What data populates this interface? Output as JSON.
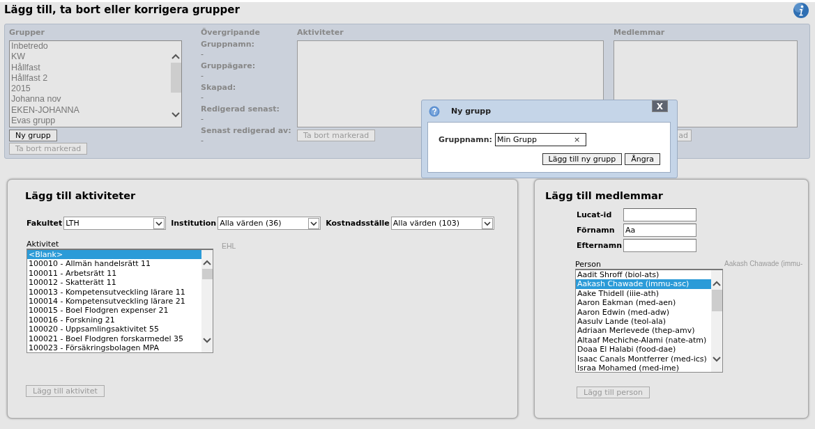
{
  "page": {
    "title": "Lägg till, ta bort eller korrigera grupper"
  },
  "groups_panel": {
    "heading": "Grupper",
    "list_disabled": true,
    "items": [
      {
        "label": "Inbetredo",
        "selected": false
      },
      {
        "label": "KW",
        "selected": false
      },
      {
        "label": "Hållfast",
        "selected": false
      },
      {
        "label": "Hållfast 2",
        "selected": false
      },
      {
        "label": "2015",
        "selected": false
      },
      {
        "label": "Johanna nov",
        "selected": false
      },
      {
        "label": "EKEN-JOHANNA",
        "selected": false
      },
      {
        "label": "Evas grupp",
        "selected": false
      }
    ],
    "buttons": [
      {
        "label": "Ny grupp",
        "disabled": false
      },
      {
        "label": "Ta bort markerad",
        "disabled": true
      }
    ]
  },
  "overview": {
    "heading": "Övergripande",
    "fields": [
      {
        "label": "Gruppnamn:",
        "value": "-"
      },
      {
        "label": "Gruppägare:",
        "value": "-"
      },
      {
        "label": "Skapad:",
        "value": "-"
      },
      {
        "label": "Redigerad senast:",
        "value": "-"
      },
      {
        "label": "Senast redigerad av:",
        "value": "-"
      }
    ]
  },
  "activities": {
    "heading": "Aktiviteter",
    "button": {
      "label": "Ta bort markerad",
      "disabled": true
    }
  },
  "members": {
    "heading": "Medlemmar",
    "button": {
      "label": "ad",
      "disabled": true
    }
  },
  "dialog": {
    "title": "Ny grupp",
    "close": "X",
    "field_label": "Gruppnamn:",
    "field_value": "Min Grupp",
    "clear": "×",
    "buttons": [
      {
        "label": "Lägg till ny grupp"
      },
      {
        "label": "Ångra"
      }
    ]
  },
  "add_activities": {
    "heading": "Lägg till aktiviteter",
    "filters": [
      {
        "label": "Fakultet",
        "value": "LTH"
      },
      {
        "label": "Institution",
        "value": "Alla värden (36)"
      },
      {
        "label": "Kostnadsställe",
        "value": "Alla värden (103)"
      }
    ],
    "list_label": "Aktivitet",
    "tooltip": "EHL",
    "items": [
      {
        "label": "<Blank>",
        "selected": true
      },
      {
        "label": "100010 - Allmän handelsrätt 11",
        "selected": false
      },
      {
        "label": "100011 - Arbetsrätt 11",
        "selected": false
      },
      {
        "label": "100012 - Skatterätt 11",
        "selected": false
      },
      {
        "label": "100013 - Kompetensutveckling lärare 11",
        "selected": false
      },
      {
        "label": "100014 - Kompetensutveckling lärare 21",
        "selected": false
      },
      {
        "label": "100015 - Boel Flodgren expenser 21",
        "selected": false
      },
      {
        "label": "100016 - Forskning 21",
        "selected": false
      },
      {
        "label": "100020 - Uppsamlingsaktivitet 55",
        "selected": false
      },
      {
        "label": "100021 - Boel Flodgren forskarmedel 35",
        "selected": false
      },
      {
        "label": "100023 - Försäkringsbolagen MPA",
        "selected": false
      }
    ],
    "button": {
      "label": "Lägg till aktivitet",
      "disabled": true
    }
  },
  "add_members": {
    "heading": "Lägg till medlemmar",
    "fields": [
      {
        "label": "Lucat-id"
      },
      {
        "label": "Förnamn",
        "value": "Aa"
      },
      {
        "label": "Efternamn"
      }
    ],
    "list_label": "Person",
    "tooltip": "Aakash Chawade (immu-",
    "items": [
      {
        "label": "Aadit Shroff (biol-ats)",
        "selected": false
      },
      {
        "label": "Aakash Chawade (immu-asc)",
        "selected": true
      },
      {
        "label": "Aake Thidell (iiie-ath)",
        "selected": false
      },
      {
        "label": "Aaron Eakman (med-aen)",
        "selected": false
      },
      {
        "label": "Aaron Edwin (med-adw)",
        "selected": false
      },
      {
        "label": "Aasulv Lande (teol-ala)",
        "selected": false
      },
      {
        "label": "Adriaan Merlevede (thep-amv)",
        "selected": false
      },
      {
        "label": "Altaaf Mechiche-Alami (nate-atm)",
        "selected": false
      },
      {
        "label": "Doaa El Halabi (food-dae)",
        "selected": false
      },
      {
        "label": "Isaac Canals Montferrer (med-ics)",
        "selected": false
      },
      {
        "label": "Israa Mohamed (med-ime)",
        "selected": false
      }
    ],
    "button": {
      "label": "Lägg till person",
      "disabled": true
    }
  }
}
